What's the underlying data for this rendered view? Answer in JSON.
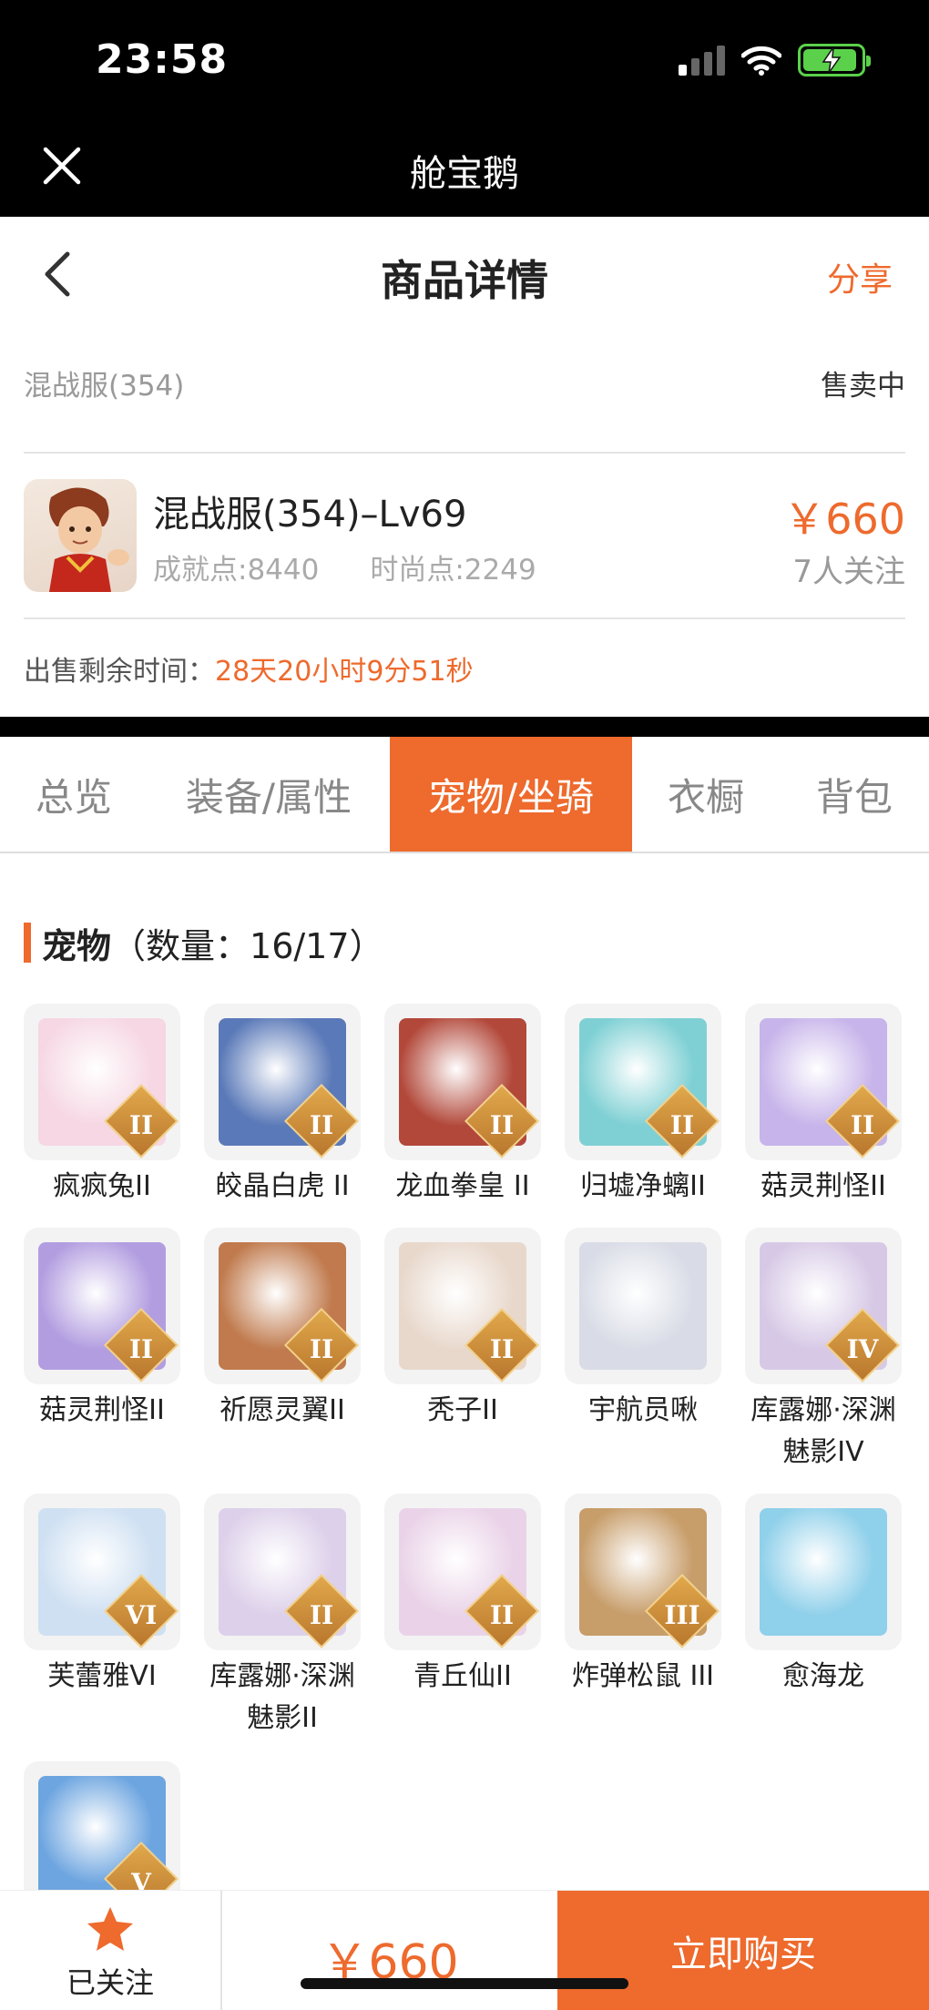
{
  "status_bar": {
    "time": "23:58"
  },
  "app_header": {
    "title": "舱宝鹅"
  },
  "page_nav": {
    "title": "商品详情",
    "share_label": "分享"
  },
  "listing": {
    "server": "混战服(354)",
    "sale_status": "售卖中",
    "product_name": "混战服(354)–Lv69",
    "achievement": "成就点:8440",
    "fashion": "时尚点:2249",
    "price": "￥660",
    "followers": "7人关注",
    "remaining_label": "出售剩余时间：",
    "remaining_time": "28天20小时9分51秒"
  },
  "tabs": [
    "总览",
    "装备/属性",
    "宠物/坐骑",
    "衣橱",
    "背包"
  ],
  "active_tab": "宠物/坐骑",
  "pets_section": {
    "title": "宠物",
    "count": "（数量：16/17）"
  },
  "pets": [
    {
      "name": "疯疯兔II",
      "badge": "II",
      "color": "#f6d7e3"
    },
    {
      "name": "皎晶白虎 II",
      "badge": "II",
      "color": "#5a79b8"
    },
    {
      "name": "龙血拳皇 II",
      "badge": "II",
      "color": "#b2483a"
    },
    {
      "name": "归墟净螭II",
      "badge": "II",
      "color": "#7fd0d4"
    },
    {
      "name": "菇灵荆怪II",
      "badge": "II",
      "color": "#c7b4ea"
    },
    {
      "name": "菇灵荆怪II",
      "badge": "II",
      "color": "#b29de0"
    },
    {
      "name": "祈愿灵翼II",
      "badge": "II",
      "color": "#c07a4d"
    },
    {
      "name": "秃子II",
      "badge": "II",
      "color": "#e8d8cc"
    },
    {
      "name": "宇航员啾",
      "badge": "",
      "color": "#d9dce6"
    },
    {
      "name": "库露娜·深渊魅影IV",
      "badge": "IV",
      "color": "#d7c9e6"
    },
    {
      "name": "芙蕾雅VI",
      "badge": "VI",
      "color": "#cfe0f2"
    },
    {
      "name": "库露娜·深渊魅影II",
      "badge": "II",
      "color": "#ddd0ea"
    },
    {
      "name": "青丘仙II",
      "badge": "II",
      "color": "#ead3e8"
    },
    {
      "name": "炸弹松鼠 III",
      "badge": "III",
      "color": "#c79d6a"
    },
    {
      "name": "愈海龙",
      "badge": "",
      "color": "#8fd0ea"
    },
    {
      "name": "",
      "badge": "V",
      "color": "#6da5e0"
    }
  ],
  "bottom_bar": {
    "follow_label": "已关注",
    "price": "￥660",
    "buy_label": "立即购买"
  },
  "colors": {
    "accent": "#ee6a2d",
    "header_bg": "#000000"
  }
}
